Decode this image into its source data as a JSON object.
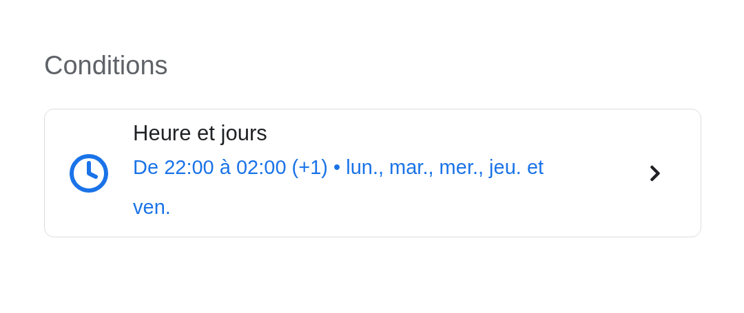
{
  "section_title": "Conditions",
  "condition": {
    "title": "Heure et jours",
    "summary": "De 22:00 à 02:00 (+1) • lun., mar., mer., jeu. et ven."
  }
}
